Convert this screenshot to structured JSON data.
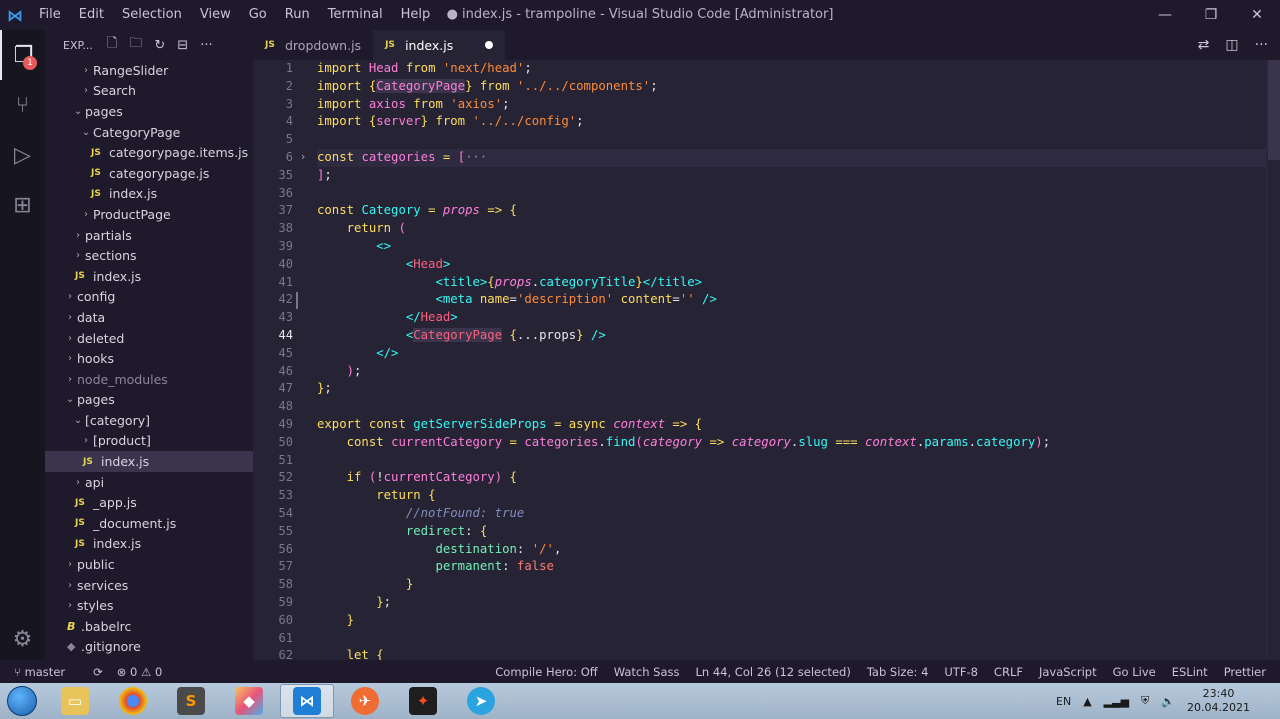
{
  "titlebar": {
    "menu": [
      "File",
      "Edit",
      "Selection",
      "View",
      "Go",
      "Run",
      "Terminal",
      "Help"
    ],
    "title": "● index.js - trampoline - Visual Studio Code [Administrator]"
  },
  "activity_bar": {
    "explorer_badge": "1"
  },
  "sidebar": {
    "header": "EXP...",
    "items": [
      {
        "label": "RangeSlider",
        "depth": 2,
        "kind": "folder"
      },
      {
        "label": "Search",
        "depth": 2,
        "kind": "folder"
      },
      {
        "label": "pages",
        "depth": 1,
        "kind": "folder-open"
      },
      {
        "label": "CategoryPage",
        "depth": 2,
        "kind": "folder-open"
      },
      {
        "label": "categorypage.items.js",
        "depth": 3,
        "kind": "js"
      },
      {
        "label": "categorypage.js",
        "depth": 3,
        "kind": "js"
      },
      {
        "label": "index.js",
        "depth": 3,
        "kind": "js"
      },
      {
        "label": "ProductPage",
        "depth": 2,
        "kind": "folder"
      },
      {
        "label": "partials",
        "depth": 1,
        "kind": "folder"
      },
      {
        "label": "sections",
        "depth": 1,
        "kind": "folder"
      },
      {
        "label": "index.js",
        "depth": 1,
        "kind": "js"
      },
      {
        "label": "config",
        "depth": 0,
        "kind": "folder"
      },
      {
        "label": "data",
        "depth": 0,
        "kind": "folder"
      },
      {
        "label": "deleted",
        "depth": 0,
        "kind": "folder"
      },
      {
        "label": "hooks",
        "depth": 0,
        "kind": "folder"
      },
      {
        "label": "node_modules",
        "depth": 0,
        "kind": "folder-dim"
      },
      {
        "label": "pages",
        "depth": 0,
        "kind": "folder-open"
      },
      {
        "label": "[category]",
        "depth": 1,
        "kind": "folder-open"
      },
      {
        "label": "[product]",
        "depth": 2,
        "kind": "folder"
      },
      {
        "label": "index.js",
        "depth": 2,
        "kind": "js-selected"
      },
      {
        "label": "api",
        "depth": 1,
        "kind": "folder"
      },
      {
        "label": "_app.js",
        "depth": 1,
        "kind": "js"
      },
      {
        "label": "_document.js",
        "depth": 1,
        "kind": "js"
      },
      {
        "label": "index.js",
        "depth": 1,
        "kind": "js"
      },
      {
        "label": "public",
        "depth": 0,
        "kind": "folder"
      },
      {
        "label": "services",
        "depth": 0,
        "kind": "folder"
      },
      {
        "label": "styles",
        "depth": 0,
        "kind": "folder"
      },
      {
        "label": ".babelrc",
        "depth": 0,
        "kind": "babel"
      },
      {
        "label": ".gitignore",
        "depth": 0,
        "kind": "git"
      }
    ]
  },
  "tabs": [
    {
      "label": "dropdown.js",
      "active": false
    },
    {
      "label": "index.js",
      "active": true
    }
  ],
  "editor": {
    "line_numbers": [
      "1",
      "2",
      "3",
      "4",
      "5",
      "6",
      "35",
      "36",
      "37",
      "38",
      "39",
      "40",
      "41",
      "42",
      "43",
      "44",
      "45",
      "46",
      "47",
      "48",
      "49",
      "50",
      "51",
      "52",
      "53",
      "54",
      "55",
      "56",
      "57",
      "58",
      "59",
      "60",
      "61",
      "62"
    ],
    "current_line": "44"
  },
  "statusbar": {
    "branch": "master",
    "problems": "⊗ 0 ⚠ 0",
    "compile_hero": "Compile Hero: Off",
    "watch_sass": "Watch Sass",
    "cursor": "Ln 44, Col 26 (12 selected)",
    "tab_size": "Tab Size: 4",
    "encoding": "UTF-8",
    "eol": "CRLF",
    "language": "JavaScript",
    "go_live": "Go Live",
    "eslint": "ESLint",
    "prettier": "Prettier"
  },
  "taskbar": {
    "lang": "EN",
    "time": "23:40",
    "date": "20.04.2021"
  }
}
